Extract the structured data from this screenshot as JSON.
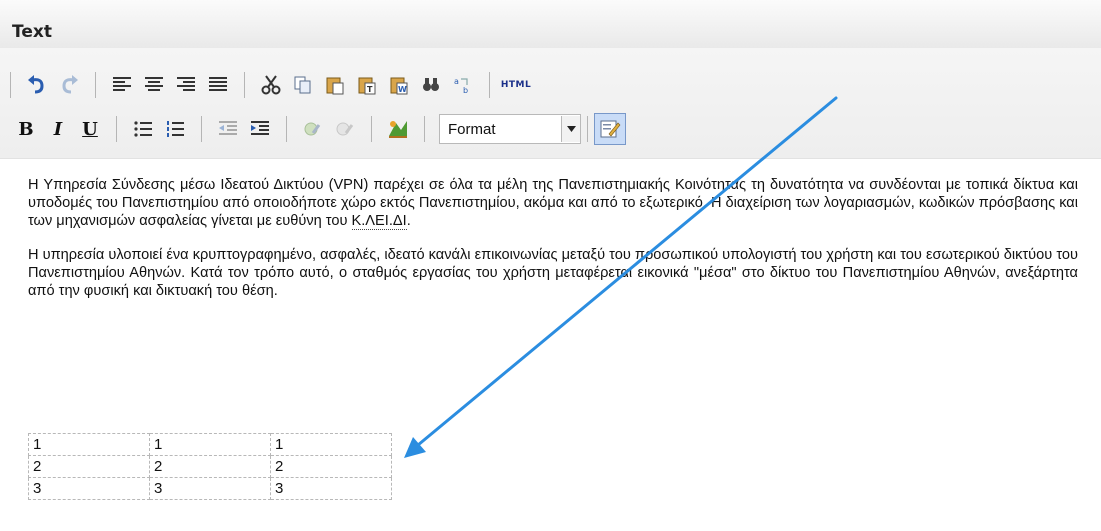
{
  "header": {
    "title": "Text"
  },
  "toolbar": {
    "row1": {
      "buttons": [
        "undo-icon",
        "redo-icon",
        "align-left-icon",
        "align-center-icon",
        "align-right-icon",
        "align-justify-icon",
        "cut-icon",
        "copy-icon",
        "paste-icon",
        "paste-text-icon",
        "paste-word-icon",
        "find-icon",
        "replace-icon",
        "html-source-icon"
      ],
      "html_label": "HTML"
    },
    "row2": {
      "bold_label": "B",
      "italic_label": "I",
      "underline_label": "U",
      "format": {
        "selected": "Format"
      }
    }
  },
  "content": {
    "paragraph1": "Η Υπηρεσία Σύνδεσης μέσω Ιδεατού Δικτύου (VPN) παρέχει σε όλα τα μέλη της Πανεπιστημιακής Κοινότητας τη δυνατότητα να συνδέονται με τοπικά δίκτυα και υποδομές του Πανεπιστημίου από οποιοδήποτε χώρο εκτός Πανεπιστημίου, ακόμα και από το εξωτερικό. Η διαχείριση των λογαριασμών, κωδικών πρόσβασης και των μηχανισμών ασφαλείας γίνεται με ευθύνη του ",
    "paragraph1_abbr": "Κ.ΛΕΙ.ΔΙ",
    "paragraph1_end": ".",
    "paragraph2": "Η υπηρεσία υλοποιεί ένα κρυπτογραφημένο, ασφαλές, ιδεατό κανάλι επικοινωνίας μεταξύ του προσωπικού υπολογιστή του χρήστη και του εσωτερικού δικτύου του Πανεπιστημίου Αθηνών. Κατά τον τρόπο αυτό, ο σταθμός εργασίας του χρήστη μεταφέρεται εικονικά \"μέσα\" στο δίκτυο του Πανεπιστημίου Αθηνών, ανεξάρτητα από την φυσική και δικτυακή του θέση."
  },
  "table": {
    "rows": [
      [
        "1",
        "1",
        "1"
      ],
      [
        "2",
        "2",
        "2"
      ],
      [
        "3",
        "3",
        "3"
      ]
    ]
  },
  "colors": {
    "arrow": "#2b8de0",
    "accent": "#c9dcf7"
  }
}
